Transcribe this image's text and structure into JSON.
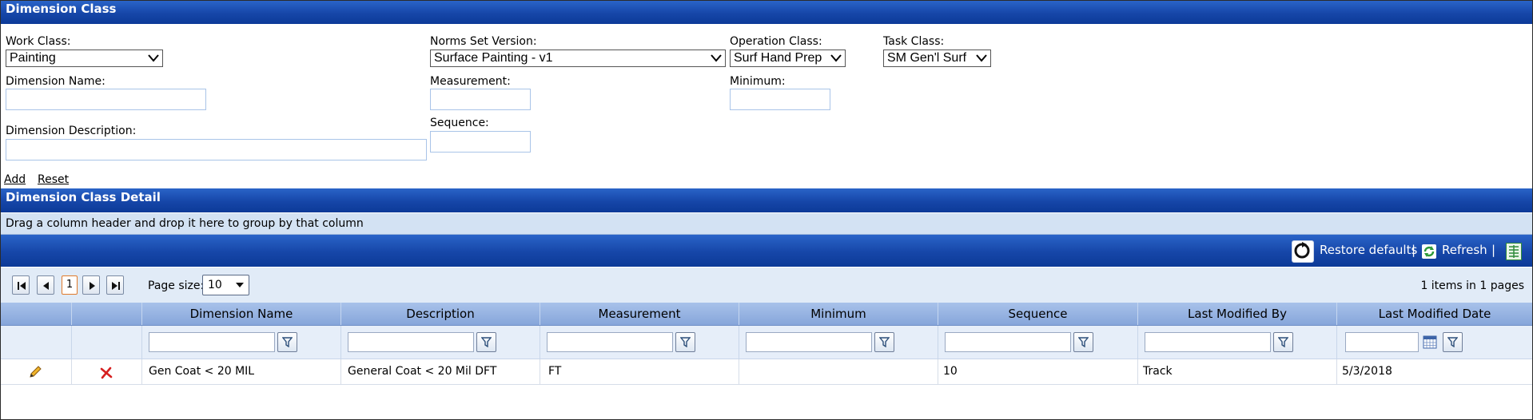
{
  "panel_title": "Dimension Class",
  "form": {
    "work_class": {
      "label": "Work Class:",
      "value": "Painting"
    },
    "norms_set_version": {
      "label": "Norms Set Version:",
      "value": "Surface Painting - v1"
    },
    "operation_class": {
      "label": "Operation Class:",
      "value": "Surf Hand Prep"
    },
    "task_class": {
      "label": "Task Class:",
      "value": "SM Gen'l Surf"
    },
    "dimension_name": {
      "label": "Dimension Name:",
      "value": ""
    },
    "measurement": {
      "label": "Measurement:",
      "value": ""
    },
    "minimum": {
      "label": "Minimum:",
      "value": ""
    },
    "dimension_description": {
      "label": "Dimension Description:",
      "value": ""
    },
    "sequence": {
      "label": "Sequence:",
      "value": ""
    }
  },
  "actions": {
    "add": "Add",
    "reset": "Reset"
  },
  "detail": {
    "title": "Dimension Class Detail",
    "group_hint": "Drag a column header and drop it here to group by that column",
    "toolbar": {
      "restore": "Restore defaults",
      "refresh": "Refresh",
      "separator": "|"
    },
    "pager": {
      "current_page": "1",
      "page_size_label": "Page size:",
      "page_size": "10",
      "summary": "1 items in 1 pages"
    },
    "columns": [
      "Dimension Name",
      "Description",
      "Measurement",
      "Minimum",
      "Sequence",
      "Last Modified By",
      "Last Modified Date"
    ],
    "rows": [
      {
        "dimension_name": "Gen Coat < 20 MIL",
        "description": "General Coat < 20 Mil DFT",
        "measurement": "FT",
        "minimum": "",
        "sequence": "10",
        "last_modified_by": "Track",
        "last_modified_date": "5/3/2018"
      }
    ]
  },
  "icons": {
    "edit": "pencil-icon",
    "delete": "delete-x-icon",
    "filter": "filter-icon",
    "calendar": "calendar-icon",
    "restore": "restore-icon",
    "refresh": "refresh-icon",
    "export": "export-excel-icon"
  },
  "colors": {
    "header_bar": "#1646a8",
    "group_panel": "#d3e2f3",
    "column_header": "#9bb7e3",
    "delete_red": "#d62020",
    "current_page_border": "#e07a2b"
  }
}
